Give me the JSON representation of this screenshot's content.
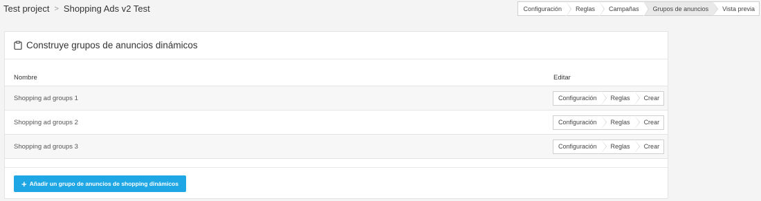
{
  "breadcrumb": {
    "project": "Test project",
    "separator": ">",
    "current": "Shopping Ads v2 Test"
  },
  "top_steps": [
    {
      "label": "Configuración",
      "active": false
    },
    {
      "label": "Reglas",
      "active": false
    },
    {
      "label": "Campañas",
      "active": false
    },
    {
      "label": "Grupos de anuncios",
      "active": true
    },
    {
      "label": "Vista previa",
      "active": false
    }
  ],
  "panel": {
    "icon": "clipboard-icon",
    "title": "Construye grupos de anuncios dinámicos"
  },
  "table": {
    "columns": {
      "name": "Nombre",
      "edit": "Editar"
    },
    "rows": [
      {
        "name": "Shopping ad groups 1",
        "steps": [
          "Configuración",
          "Reglas",
          "Crear"
        ]
      },
      {
        "name": "Shopping ad groups 2",
        "steps": [
          "Configuración",
          "Reglas",
          "Crear"
        ]
      },
      {
        "name": "Shopping ad groups 3",
        "steps": [
          "Configuración",
          "Reglas",
          "Crear"
        ]
      }
    ]
  },
  "add_button": {
    "icon": "plus-icon",
    "label": "Añadir un grupo de anuncios de shopping dinámicos"
  },
  "colors": {
    "accent": "#1ea7e4",
    "background": "#f4f4f4",
    "active_step": "#e9e9e9"
  }
}
